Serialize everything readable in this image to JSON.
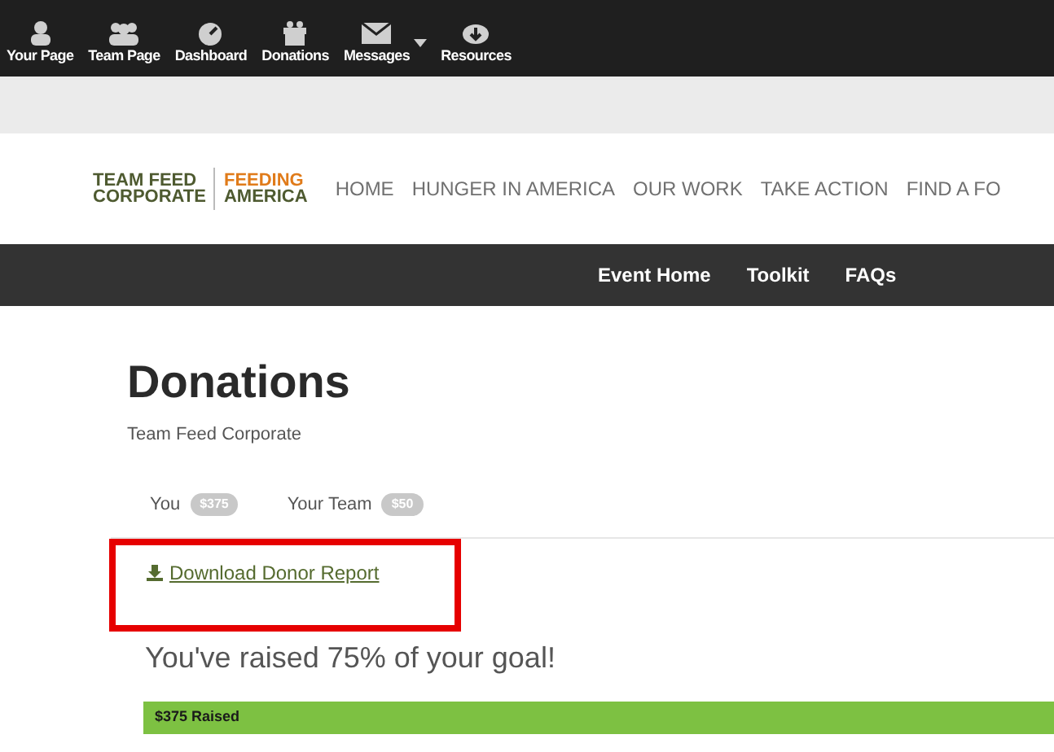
{
  "toolbar": {
    "items": [
      {
        "label": "Your Page",
        "dropdown": false
      },
      {
        "label": "Team Page",
        "dropdown": false
      },
      {
        "label": "Dashboard",
        "dropdown": false
      },
      {
        "label": "Donations",
        "dropdown": false
      },
      {
        "label": "Messages",
        "dropdown": true
      },
      {
        "label": "Resources",
        "dropdown": false
      }
    ]
  },
  "logo": {
    "left": [
      "TEAM FEED",
      "CORPORATE"
    ],
    "right": [
      "FEEDING",
      "AMERICA"
    ]
  },
  "main_nav": [
    "HOME",
    "HUNGER IN AMERICA",
    "OUR WORK",
    "TAKE ACTION",
    "FIND A FO"
  ],
  "sub_nav": [
    "Event Home",
    "Toolkit",
    "FAQs"
  ],
  "page": {
    "title": "Donations",
    "subtitle": "Team Feed Corporate"
  },
  "tabs": [
    {
      "label": "You",
      "badge": "$375"
    },
    {
      "label": "Your Team",
      "badge": "$50"
    }
  ],
  "download_link": "Download Donor Report",
  "progress": {
    "message": "You've raised 75% of your goal!",
    "level": 0.75,
    "label": "$375 Raised"
  }
}
